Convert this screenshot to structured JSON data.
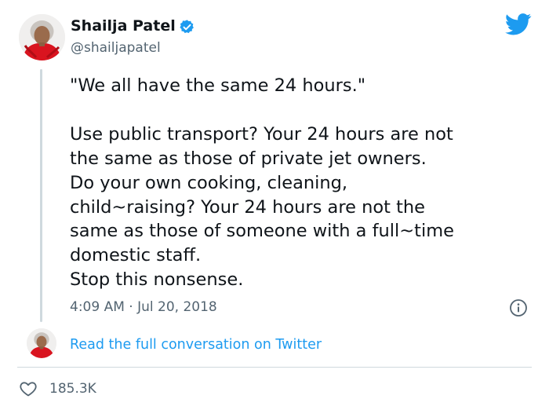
{
  "tweet": {
    "author": {
      "name": "Shailja Patel",
      "handle": "@shailjapatel",
      "verified": true
    },
    "text": "\"We all have the same 24 hours.\"\n\nUse public transport? Your 24 hours are not\nthe same as those of private jet owners.\nDo your own cooking, cleaning,\nchild~raising? Your 24 hours are not the\nsame as those of someone with a full~time\ndomestic staff.\nStop this nonsense.",
    "timestamp": "4:09 AM · Jul 20, 2018",
    "conversation_link": "Read the full conversation on Twitter",
    "likes": "185.3K"
  },
  "icons": {
    "brand": "twitter-bird-icon",
    "verified": "verified-badge-icon",
    "info": "info-icon",
    "like": "heart-icon"
  },
  "colors": {
    "accent": "#1d9bf0",
    "text": "#0f1419",
    "muted": "#536471",
    "divider": "#cfd9de"
  }
}
